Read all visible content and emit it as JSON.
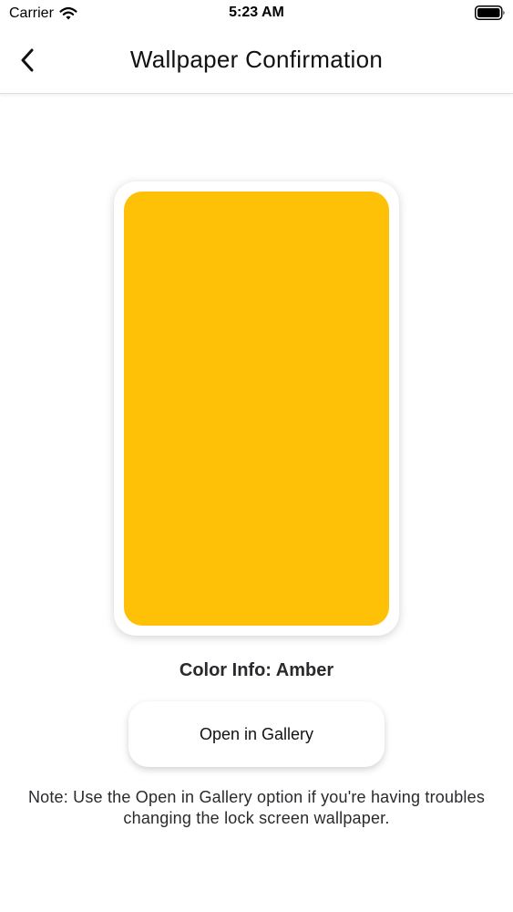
{
  "status_bar": {
    "carrier": "Carrier",
    "time": "5:23 AM",
    "icons": [
      "wifi-icon",
      "battery-icon"
    ]
  },
  "nav": {
    "title": "Wallpaper Confirmation",
    "back_icon": "chevron-left-icon"
  },
  "preview": {
    "color_name": "Amber",
    "color_hex": "#FFC107"
  },
  "color_info": {
    "label": "Color Info: Amber"
  },
  "actions": {
    "open_gallery_label": "Open in Gallery"
  },
  "note": {
    "text": "Note: Use the Open in Gallery option if you're having troubles changing the lock screen wallpaper."
  }
}
